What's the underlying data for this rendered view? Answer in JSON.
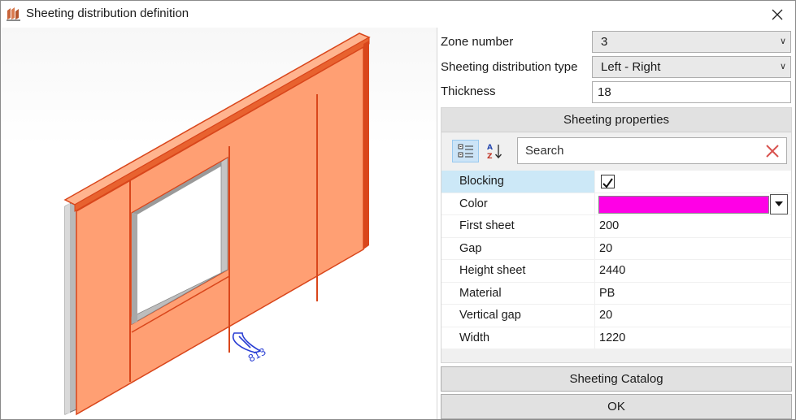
{
  "window": {
    "title": "Sheeting distribution definition"
  },
  "form": {
    "zone_number": {
      "label": "Zone number",
      "value": "3"
    },
    "distribution_type": {
      "label": "Sheeting distribution type",
      "value": "Left - Right"
    },
    "thickness": {
      "label": "Thickness",
      "value": "18"
    }
  },
  "properties": {
    "header": "Sheeting properties",
    "search_placeholder": "Search",
    "rows": [
      {
        "name": "Blocking",
        "value": "",
        "type": "checkbox",
        "checked": true
      },
      {
        "name": "Color",
        "value": "",
        "type": "color",
        "color": "#ff00e6"
      },
      {
        "name": "First sheet",
        "value": "200"
      },
      {
        "name": "Gap",
        "value": "20"
      },
      {
        "name": "Height sheet",
        "value": "2440"
      },
      {
        "name": "Material",
        "value": "PB"
      },
      {
        "name": "Vertical gap",
        "value": "20"
      },
      {
        "name": "Width",
        "value": "1220"
      }
    ]
  },
  "buttons": {
    "catalog": "Sheeting Catalog",
    "ok": "OK"
  },
  "colors": {
    "sheet_fill": "#ff9f73",
    "sheet_edge": "#d9461b",
    "selection": "#cce8f7",
    "accent": "#ff00e6"
  }
}
